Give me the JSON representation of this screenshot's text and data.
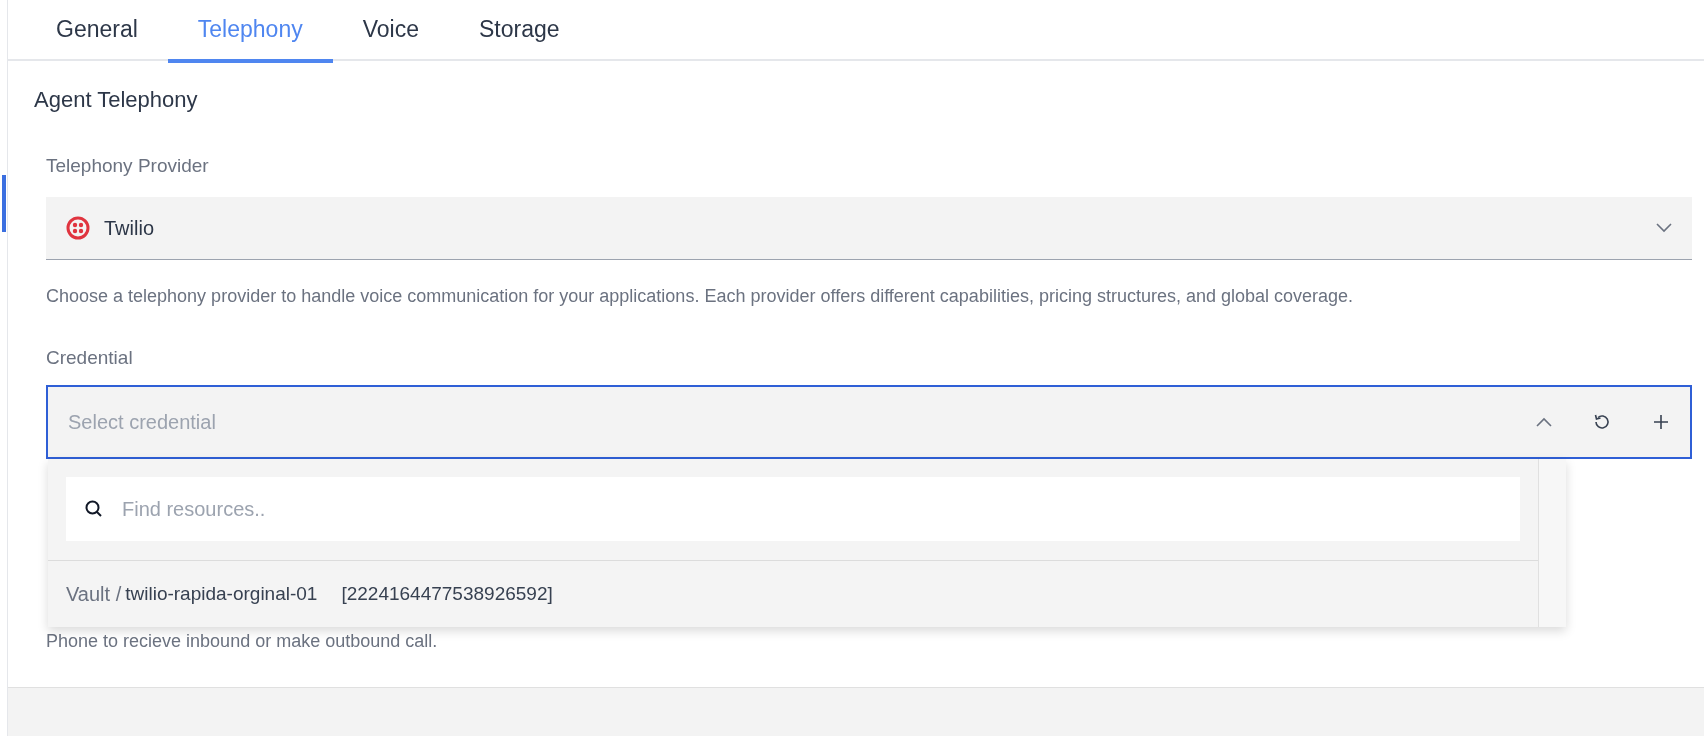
{
  "tabs": [
    {
      "label": "General",
      "selected": false
    },
    {
      "label": "Telephony",
      "selected": true
    },
    {
      "label": "Voice",
      "selected": false
    },
    {
      "label": "Storage",
      "selected": false
    }
  ],
  "section_title": "Agent Telephony",
  "provider": {
    "label": "Telephony Provider",
    "value": "Twilio",
    "help": "Choose a telephony provider to handle voice communication for your applications. Each provider offers different capabilities, pricing structures, and global coverage."
  },
  "credential": {
    "label": "Credential",
    "placeholder": "Select credential",
    "expanded": true,
    "dropdown": {
      "search_placeholder": "Find resources..",
      "options": [
        {
          "prefix": "Vault /",
          "name": "twilio-rapida-orginal-01",
          "id": "[2224164477538926592]"
        }
      ]
    }
  },
  "phone_help": "Phone to recieve inbound or make outbound call."
}
